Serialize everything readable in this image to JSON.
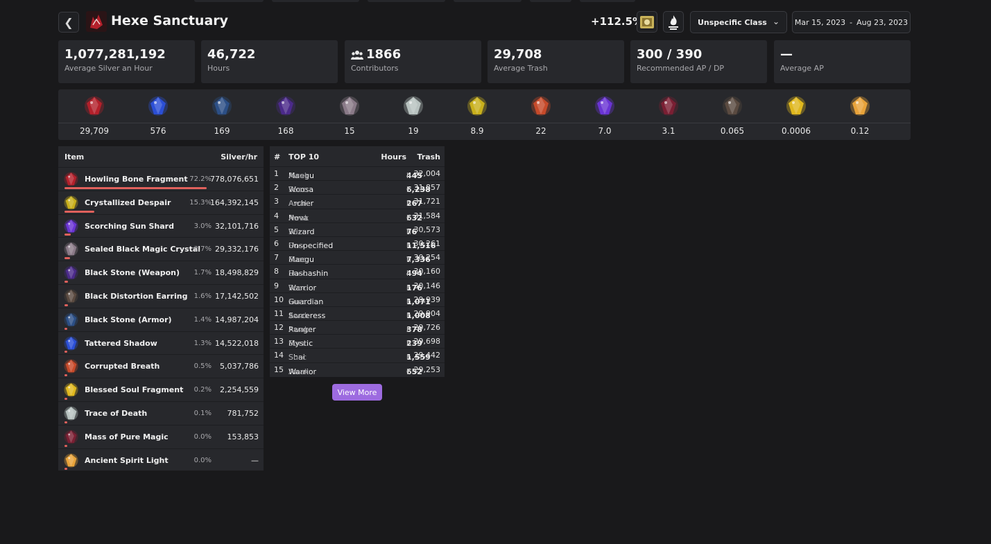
{
  "header": {
    "title": "Hexe Sanctuary",
    "bonus": "+112.5%",
    "class_select": "Unspecific Class",
    "date_from": "Mar 15, 2023",
    "date_sep": "-",
    "date_to": "Aug 23, 2023"
  },
  "stats": [
    {
      "value": "1,077,281,192",
      "label": "Average Silver an Hour"
    },
    {
      "value": "46,722",
      "label": "Hours"
    },
    {
      "value": "1866",
      "label": "Contributors",
      "icon": "users-icon"
    },
    {
      "value": "29,708",
      "label": "Average Trash"
    },
    {
      "value": "300 / 390",
      "label": "Recommended AP / DP"
    },
    {
      "value": "—",
      "label": "Average AP"
    }
  ],
  "drops": [
    {
      "icon": "howling-bone-fragment-icon",
      "value": "29,709",
      "color": "#b3202b"
    },
    {
      "icon": "tattered-shadow-icon",
      "value": "576",
      "color": "#2b4fd6"
    },
    {
      "icon": "black-stone-armor-icon",
      "value": "169",
      "color": "#2c4f86"
    },
    {
      "icon": "black-stone-weapon-icon",
      "value": "168",
      "color": "#4b2a8a"
    },
    {
      "icon": "sealed-black-magic-crystal-icon",
      "value": "15",
      "color": "#8a7a88"
    },
    {
      "icon": "trace-of-death-icon",
      "value": "19",
      "color": "#b8c2c0"
    },
    {
      "icon": "crystallized-despair-icon",
      "value": "8.9",
      "color": "#c9b01c"
    },
    {
      "icon": "corrupted-breath-icon",
      "value": "22",
      "color": "#c64a2a"
    },
    {
      "icon": "scorching-sun-shard-icon",
      "value": "7.0",
      "color": "#6a34d4"
    },
    {
      "icon": "mass-of-pure-magic-icon",
      "value": "3.1",
      "color": "#7a1f33"
    },
    {
      "icon": "black-distortion-earring-icon",
      "value": "0.065",
      "color": "#5a4a40"
    },
    {
      "icon": "blessed-soul-fragment-icon",
      "value": "0.0006",
      "color": "#e0b81e"
    },
    {
      "icon": "ancient-spirit-light-icon",
      "value": "0.12",
      "color": "#e8a33a"
    }
  ],
  "items_table": {
    "col_item": "Item",
    "col_silver": "Silver/hr",
    "rows": [
      {
        "name": "Howling Bone Fragment",
        "pct": "72.2%",
        "pct_value": 72.2,
        "silver": "778,076,651",
        "color": "#b3202b"
      },
      {
        "name": "Crystallized Despair",
        "pct": "15.3%",
        "pct_value": 15.3,
        "silver": "164,392,145",
        "color": "#c9b01c"
      },
      {
        "name": "Scorching Sun Shard",
        "pct": "3.0%",
        "pct_value": 3.0,
        "silver": "32,101,716",
        "color": "#6a34d4"
      },
      {
        "name": "Sealed Black Magic Crystal",
        "pct": "2.7%",
        "pct_value": 2.7,
        "silver": "29,332,176",
        "color": "#8a7a88"
      },
      {
        "name": "Black Stone (Weapon)",
        "pct": "1.7%",
        "pct_value": 1.7,
        "silver": "18,498,829",
        "color": "#4b2a8a"
      },
      {
        "name": "Black Distortion Earring",
        "pct": "1.6%",
        "pct_value": 1.6,
        "silver": "17,142,502",
        "color": "#5a4a40"
      },
      {
        "name": "Black Stone (Armor)",
        "pct": "1.4%",
        "pct_value": 1.4,
        "silver": "14,987,204",
        "color": "#2c4f86"
      },
      {
        "name": "Tattered Shadow",
        "pct": "1.3%",
        "pct_value": 1.3,
        "silver": "14,522,018",
        "color": "#2b4fd6"
      },
      {
        "name": "Corrupted Breath",
        "pct": "0.5%",
        "pct_value": 0.5,
        "silver": "5,037,786",
        "color": "#c64a2a"
      },
      {
        "name": "Blessed Soul Fragment",
        "pct": "0.2%",
        "pct_value": 0.2,
        "silver": "2,254,559",
        "color": "#e0b81e"
      },
      {
        "name": "Trace of Death",
        "pct": "0.1%",
        "pct_value": 0.1,
        "silver": "781,752",
        "color": "#b8c2c0"
      },
      {
        "name": "Mass of Pure Magic",
        "pct": "0.0%",
        "pct_value": 0.0,
        "silver": "153,853",
        "color": "#7a1f33"
      },
      {
        "name": "Ancient Spirit Light",
        "pct": "0.0%",
        "pct_value": 0.0,
        "silver": "—",
        "color": "#e8a33a"
      }
    ]
  },
  "top_table": {
    "col_rank": "#",
    "col_class": "TOP 10",
    "col_hours": "Hours",
    "col_trash": "Trash",
    "hours_unit": "h",
    "rows": [
      {
        "rank": "1",
        "cls": "Maegu",
        "spec": "Awak",
        "hours": "445",
        "trash": "32,004"
      },
      {
        "rank": "2",
        "cls": "Woosa",
        "spec": "Succ",
        "hours": "6,238",
        "trash": "31,857"
      },
      {
        "rank": "3",
        "cls": "Archer",
        "spec": "Awak",
        "hours": "267",
        "trash": "31,721"
      },
      {
        "rank": "4",
        "cls": "Nova",
        "spec": "Awak",
        "hours": "632",
        "trash": "31,584"
      },
      {
        "rank": "5",
        "cls": "Wizard",
        "spec": "Succ",
        "hours": "76",
        "trash": "30,573"
      },
      {
        "rank": "6",
        "cls": "Unspecified",
        "spec": "Succ",
        "hours": "11,516",
        "trash": "30,261"
      },
      {
        "rank": "7",
        "cls": "Maegu",
        "spec": "Succ",
        "hours": "7,336",
        "trash": "30,254"
      },
      {
        "rank": "8",
        "cls": "Hashashin",
        "spec": "Succ",
        "hours": "494",
        "trash": "30,160"
      },
      {
        "rank": "9",
        "cls": "Warrior",
        "spec": "Succ",
        "hours": "176",
        "trash": "30,146"
      },
      {
        "rank": "10",
        "cls": "Guardian",
        "spec": "Succ",
        "hours": "1,071",
        "trash": "29,939"
      },
      {
        "rank": "11",
        "cls": "Sorceress",
        "spec": "Awak",
        "hours": "1,008",
        "trash": "29,904"
      },
      {
        "rank": "12",
        "cls": "Ranger",
        "spec": "Awak",
        "hours": "378",
        "trash": "29,726"
      },
      {
        "rank": "13",
        "cls": "Mystic",
        "spec": "Succ",
        "hours": "239",
        "trash": "29,698"
      },
      {
        "rank": "14",
        "cls": "Shai",
        "spec": "Succ",
        "hours": "1,559",
        "trash": "29,442"
      },
      {
        "rank": "15",
        "cls": "Warrior",
        "spec": "Awak",
        "hours": "652",
        "trash": "29,253"
      }
    ],
    "view_more": "View More"
  },
  "colors": {
    "background": "#19191b",
    "panel": "#27282c",
    "accent": "#9d6be0",
    "bar": "#e0615c"
  }
}
